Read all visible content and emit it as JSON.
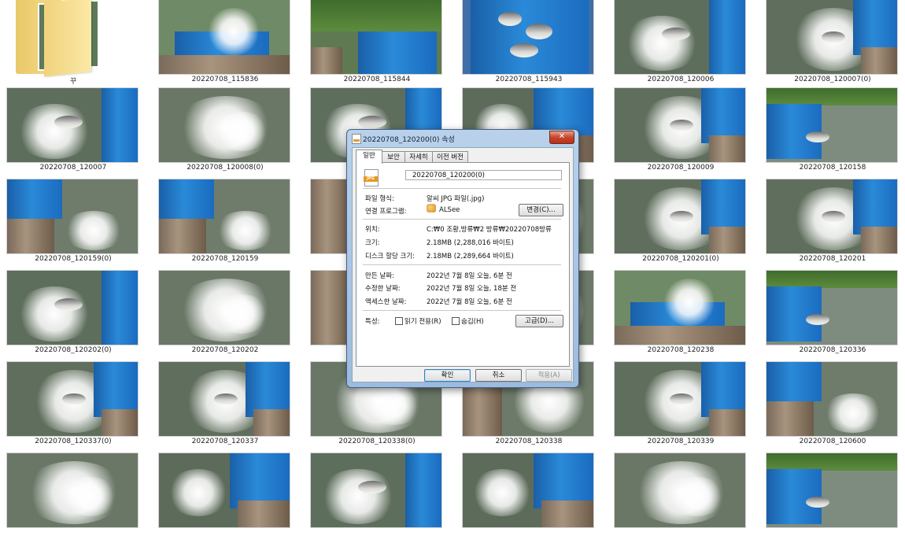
{
  "explorer": {
    "folder": {
      "label": "꾸"
    },
    "tiles": [
      {
        "label": "20220708_115836",
        "scene": "net"
      },
      {
        "label": "20220708_115844",
        "scene": "bucketman"
      },
      {
        "label": "20220708_115943",
        "scene": "bucketfish"
      },
      {
        "label": "20220708_120006",
        "scene": "throw"
      },
      {
        "label": "20220708_120007(0)",
        "scene": "splashbucket"
      },
      {
        "label": "20220708_120007",
        "scene": "throw"
      },
      {
        "label": "20220708_120008(0)",
        "scene": "splash"
      },
      {
        "label": "",
        "scene": "throw"
      },
      {
        "label": "",
        "scene": "bucket"
      },
      {
        "label": "20220708_120009",
        "scene": "splashbucket"
      },
      {
        "label": "20220708_120158",
        "scene": "lake"
      },
      {
        "label": "20220708_120159(0)",
        "scene": "pour"
      },
      {
        "label": "20220708_120159",
        "scene": "pour"
      },
      {
        "label": "",
        "scene": "board"
      },
      {
        "label": "",
        "scene": "board"
      },
      {
        "label": "20220708_120201(0)",
        "scene": "splashbucket"
      },
      {
        "label": "20220708_120201",
        "scene": "splashbucket"
      },
      {
        "label": "20220708_120202(0)",
        "scene": "throw"
      },
      {
        "label": "20220708_120202",
        "scene": "splash"
      },
      {
        "label": "",
        "scene": "board"
      },
      {
        "label": "",
        "scene": "board"
      },
      {
        "label": "20220708_120238",
        "scene": "net"
      },
      {
        "label": "20220708_120336",
        "scene": "lake"
      },
      {
        "label": "20220708_120337(0)",
        "scene": "splashbucket"
      },
      {
        "label": "20220708_120337",
        "scene": "splashbucket"
      },
      {
        "label": "20220708_120338(0)",
        "scene": "splash"
      },
      {
        "label": "20220708_120338",
        "scene": "board"
      },
      {
        "label": "20220708_120339",
        "scene": "splashbucket"
      },
      {
        "label": "20220708_120600",
        "scene": "pour"
      },
      {
        "label": "",
        "scene": "splash"
      },
      {
        "label": "",
        "scene": "bucket"
      },
      {
        "label": "",
        "scene": "throw"
      },
      {
        "label": "",
        "scene": "bucket"
      },
      {
        "label": "",
        "scene": "splash"
      },
      {
        "label": "",
        "scene": "lake"
      }
    ]
  },
  "dialog": {
    "title": "20220708_120200(0) 속성",
    "close_glyph": "✕",
    "tabs": [
      "일반",
      "보안",
      "자세히",
      "이전 버전"
    ],
    "file_icon_text": "JPG",
    "file_name": "20220708_120200(0)",
    "rows": {
      "file_type": {
        "label": "파일 형식:",
        "value": "알씨 JPG 파일(.jpg)"
      },
      "open_with": {
        "label": "연결 프로그램:",
        "value": "ALSee",
        "button": "변경(C)..."
      },
      "location": {
        "label": "위치:",
        "value": "C:₩0 조황,방류₩2 방류₩20220708방류"
      },
      "size": {
        "label": "크기:",
        "value": "2.18MB (2,288,016 바이트)"
      },
      "size_on_disk": {
        "label": "디스크 할당 크기:",
        "value": "2.18MB (2,289,664 바이트)"
      },
      "created": {
        "label": "만든 날짜:",
        "value": "2022년 7월 8일 오늘, 6분 전"
      },
      "modified": {
        "label": "수정한 날짜:",
        "value": "2022년 7월 8일 오늘, 18분 전"
      },
      "accessed": {
        "label": "액세스한 날짜:",
        "value": "2022년 7월 8일 오늘, 6분 전"
      },
      "attributes": {
        "label": "특성:",
        "readonly": "읽기 전용(R)",
        "hidden": "숨김(H)",
        "advanced": "고급(D)..."
      }
    },
    "buttons": {
      "ok": "확인",
      "cancel": "취소",
      "apply": "적용(A)"
    }
  }
}
